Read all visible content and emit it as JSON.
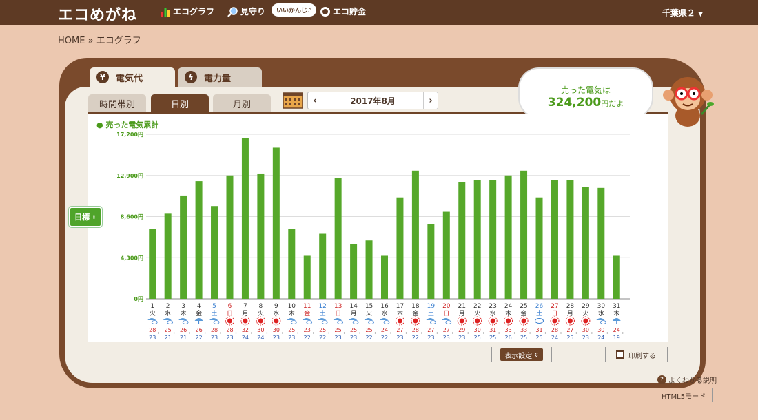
{
  "header": {
    "logo": "エコめがね",
    "nav": [
      {
        "label": "エコグラフ",
        "icon": "bar-chart-icon"
      },
      {
        "label": "見守り",
        "icon": "magnifier-icon"
      },
      {
        "label": "エコ貯金",
        "icon": "coin-icon"
      }
    ],
    "bubble": "いいかんじ♪",
    "prefecture": "千葉県２"
  },
  "breadcrumb": {
    "home": "HOME",
    "sep": "»",
    "current": "エコグラフ"
  },
  "tabs_main": [
    {
      "label": "電気代",
      "icon": "yen-icon",
      "active": true
    },
    {
      "label": "電力量",
      "icon": "lightning-icon",
      "active": false
    }
  ],
  "tabs_period": [
    {
      "label": "時間帯別",
      "active": false
    },
    {
      "label": "日別",
      "active": true
    },
    {
      "label": "月別",
      "active": false
    }
  ],
  "date_nav": {
    "prev": "‹",
    "label": "2017年8月",
    "next": "›"
  },
  "speech": {
    "line1": "売った電気は",
    "amount": "324,200",
    "suffix": "円だよ"
  },
  "goal_button": "目標",
  "settings_button": "表示設定",
  "print_button": "印刷する",
  "help_link": "よくわかる説明",
  "html5_link": "HTML5モード",
  "colors": {
    "bar": "#56a82a",
    "brown": "#5e3a24",
    "sat": "#3a7fd0",
    "sun": "#cc2020"
  },
  "chart_data": {
    "type": "bar",
    "series": [
      {
        "name": "売った電気累計"
      }
    ],
    "yticks": [
      "17,200円",
      "12,900円",
      "8,600円",
      "4,300円",
      "0円"
    ],
    "ylim": [
      0,
      17200
    ],
    "values": [
      7300,
      8900,
      10800,
      12300,
      9700,
      12900,
      16800,
      13100,
      15800,
      7300,
      4500,
      6800,
      12600,
      5700,
      6100,
      4500,
      10600,
      13400,
      7800,
      9100,
      12200,
      12400,
      12400,
      12900,
      13400,
      10600,
      12400,
      12400,
      11700,
      11600,
      4500
    ],
    "days": [
      "1",
      "2",
      "3",
      "4",
      "5",
      "6",
      "7",
      "8",
      "9",
      "10",
      "11",
      "12",
      "13",
      "14",
      "15",
      "16",
      "17",
      "18",
      "19",
      "20",
      "21",
      "22",
      "23",
      "24",
      "25",
      "26",
      "27",
      "28",
      "29",
      "30",
      "31"
    ],
    "weekdays": [
      "火",
      "水",
      "木",
      "金",
      "土",
      "日",
      "月",
      "火",
      "水",
      "木",
      "金",
      "土",
      "日",
      "月",
      "火",
      "水",
      "木",
      "金",
      "土",
      "日",
      "月",
      "火",
      "水",
      "木",
      "金",
      "土",
      "日",
      "月",
      "火",
      "水",
      "木"
    ],
    "day_colors": [
      "n",
      "n",
      "n",
      "n",
      "sat",
      "sun",
      "n",
      "n",
      "n",
      "n",
      "sun",
      "sat",
      "sun",
      "n",
      "n",
      "n",
      "n",
      "n",
      "sat",
      "sun",
      "n",
      "n",
      "n",
      "n",
      "n",
      "sat",
      "sun",
      "n",
      "n",
      "n",
      "n"
    ],
    "weather": [
      "rain",
      "rain",
      "rain",
      "umbrella",
      "rain",
      "sun",
      "sun",
      "sun",
      "sun",
      "rain",
      "rain",
      "rain",
      "rain",
      "rain",
      "rain",
      "rain",
      "sun",
      "sun",
      "rain",
      "rain",
      "sun",
      "sun",
      "sun",
      "sun",
      "sun",
      "cloud",
      "sun",
      "sun",
      "sun",
      "rain",
      "umbrella"
    ],
    "temp_high": [
      "28",
      "25",
      "26",
      "26",
      "28",
      "28",
      "32",
      "30",
      "30",
      "25",
      "23",
      "25",
      "25",
      "25",
      "25",
      "24",
      "27",
      "28",
      "27",
      "27",
      "29",
      "30",
      "31",
      "33",
      "33",
      "31",
      "28",
      "27",
      "30",
      "30",
      "24"
    ],
    "temp_low": [
      "23",
      "21",
      "21",
      "22",
      "23",
      "23",
      "24",
      "24",
      "23",
      "23",
      "22",
      "22",
      "23",
      "23",
      "22",
      "22",
      "23",
      "22",
      "23",
      "23",
      "23",
      "25",
      "25",
      "26",
      "25",
      "25",
      "24",
      "25",
      "23",
      "24",
      "19"
    ],
    "temp_unit": "°"
  }
}
